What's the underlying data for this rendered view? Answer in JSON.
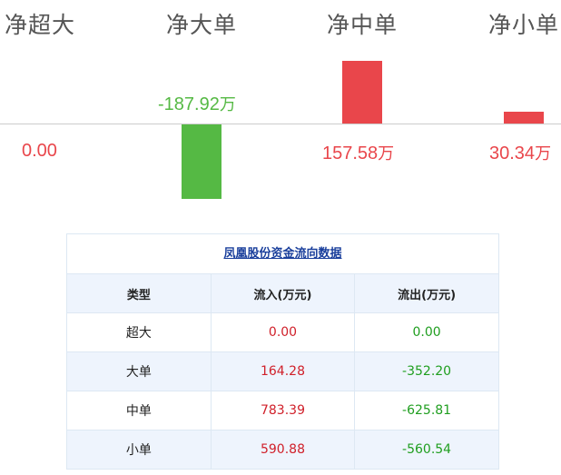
{
  "chart_data": {
    "type": "bar",
    "categories": [
      "净超大",
      "净大单",
      "净中单",
      "净小单"
    ],
    "values": [
      0.0,
      -187.92,
      157.58,
      30.34
    ],
    "value_labels": [
      "0.00",
      "-187.92",
      "157.58",
      "30.34"
    ],
    "unit": "万",
    "colors": {
      "positive": "#e9464b",
      "negative": "#55b944",
      "zero": "#e9464b"
    }
  },
  "table": {
    "title": "凤凰股份资金流向数据",
    "headers": [
      "类型",
      "流入(万元)",
      "流出(万元)"
    ],
    "rows": [
      {
        "type": "超大",
        "inflow": "0.00",
        "outflow": "0.00"
      },
      {
        "type": "大单",
        "inflow": "164.28",
        "outflow": "-352.20"
      },
      {
        "type": "中单",
        "inflow": "783.39",
        "outflow": "-625.81"
      },
      {
        "type": "小单",
        "inflow": "590.88",
        "outflow": "-560.54"
      }
    ]
  }
}
